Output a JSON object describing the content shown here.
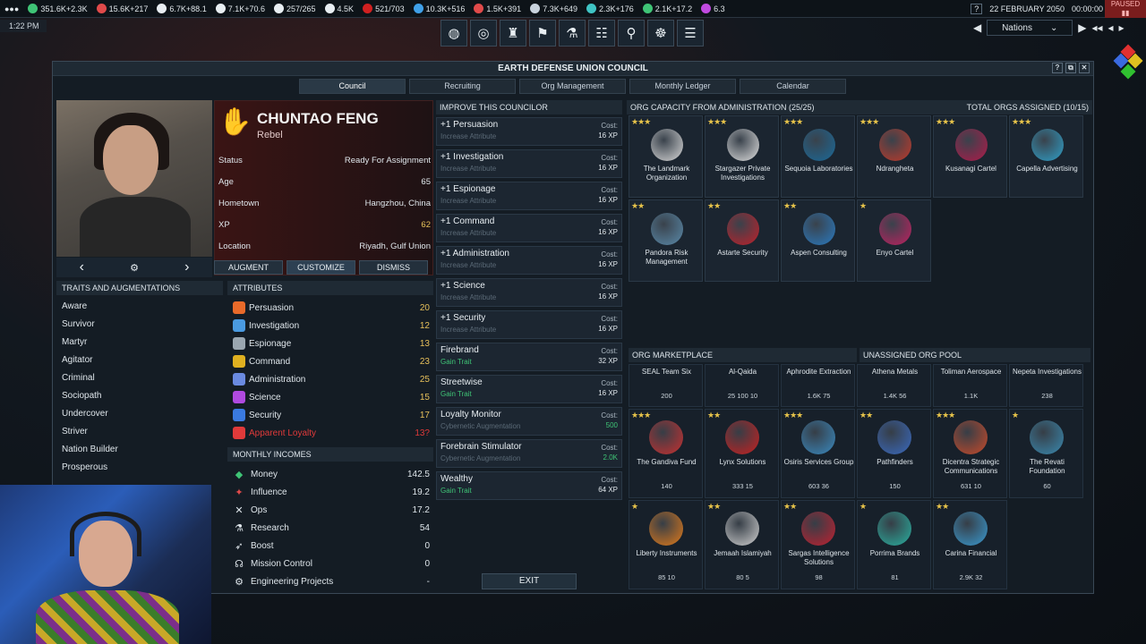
{
  "topbar": {
    "resources": [
      {
        "icon": "money-icon",
        "value": "351.6K+2.3K",
        "color": "#3fc476"
      },
      {
        "icon": "influence-icon",
        "value": "15.6K+217",
        "color": "#e04a4a"
      },
      {
        "icon": "ops-icon",
        "value": "6.7K+88.1",
        "color": "#e8eef2"
      },
      {
        "icon": "boost-icon",
        "value": "7.1K+70.6",
        "color": "#e8eef2"
      },
      {
        "icon": "mission-control-icon",
        "value": "257/265",
        "color": "#e8eef2"
      },
      {
        "icon": "research-icon",
        "value": "4.5K",
        "color": "#e8eef2"
      },
      {
        "icon": "control-points-icon",
        "value": "521/703",
        "color": "#d02020"
      },
      {
        "icon": "water-icon",
        "value": "10.3K+516",
        "color": "#3fa0e8"
      },
      {
        "icon": "volatiles-icon",
        "value": "1.5K+391",
        "color": "#e04a4a"
      },
      {
        "icon": "metals-icon",
        "value": "7.3K+649",
        "color": "#c8d2dc"
      },
      {
        "icon": "nobles-icon",
        "value": "2.3K+176",
        "color": "#3fc4c4"
      },
      {
        "icon": "fissiles-icon",
        "value": "2.1K+17.2",
        "color": "#3fc476"
      },
      {
        "icon": "antimatter-icon",
        "value": "6.3",
        "color": "#c04ae0"
      }
    ],
    "date": "22 FEBRUARY 2050",
    "clock": "00:00:00",
    "paused": "PAUSED",
    "help": "?"
  },
  "local_time": "1:22 PM",
  "nav_select": "Nations",
  "window": {
    "title": "EARTH DEFENSE UNION COUNCIL",
    "tabs": [
      "Council",
      "Recruiting",
      "Org Management",
      "Monthly Ledger",
      "Calendar"
    ]
  },
  "councilor": {
    "name": "CHUNTAO FENG",
    "faction": "Rebel",
    "rows": [
      {
        "label": "Status",
        "value": "Ready For Assignment"
      },
      {
        "label": "Age",
        "value": "65"
      },
      {
        "label": "Hometown",
        "value": "Hangzhou, China"
      },
      {
        "label": "XP",
        "value": "62"
      },
      {
        "label": "Location",
        "value": "Riyadh, Gulf Union"
      }
    ],
    "buttons": {
      "augment": "AUGMENT",
      "customize": "CUSTOMIZE",
      "dismiss": "DISMISS"
    }
  },
  "traits": {
    "header": "TRAITS AND AUGMENTATIONS",
    "items": [
      "Aware",
      "Survivor",
      "Martyr",
      "Agitator",
      "Criminal",
      "Sociopath",
      "Undercover",
      "Striver",
      "Nation Builder",
      "Prosperous"
    ]
  },
  "attributes": {
    "header": "ATTRIBUTES",
    "items": [
      {
        "name": "Persuasion",
        "value": "20",
        "color": "#e86a2a"
      },
      {
        "name": "Investigation",
        "value": "12",
        "color": "#4a9ae0"
      },
      {
        "name": "Espionage",
        "value": "13",
        "color": "#9aa6b0"
      },
      {
        "name": "Command",
        "value": "23",
        "color": "#e0b020"
      },
      {
        "name": "Administration",
        "value": "25",
        "color": "#6a8ae0"
      },
      {
        "name": "Science",
        "value": "15",
        "color": "#b04ae0"
      },
      {
        "name": "Security",
        "value": "17",
        "color": "#3a7ae0"
      },
      {
        "name": "Apparent Loyalty",
        "value": "13?",
        "color": "#e03a3a"
      }
    ]
  },
  "incomes": {
    "header": "MONTHLY INCOMES",
    "items": [
      {
        "name": "Money",
        "value": "142.5",
        "icon": "money-icon"
      },
      {
        "name": "Influence",
        "value": "19.2",
        "icon": "influence-icon"
      },
      {
        "name": "Ops",
        "value": "17.2",
        "icon": "ops-icon"
      },
      {
        "name": "Research",
        "value": "54",
        "icon": "research-icon"
      },
      {
        "name": "Boost",
        "value": "0",
        "icon": "boost-icon"
      },
      {
        "name": "Mission Control",
        "value": "0",
        "icon": "mission-control-icon"
      },
      {
        "name": "Engineering Projects",
        "value": "-",
        "icon": "engineering-icon"
      }
    ]
  },
  "improve": {
    "header": "IMPROVE THIS COUNCILOR",
    "items": [
      {
        "title": "+1 Persuasion",
        "sub": "Increase Attribute",
        "cost_label": "Cost:",
        "cost": "16 XP"
      },
      {
        "title": "+1 Investigation",
        "sub": "Increase Attribute",
        "cost_label": "Cost:",
        "cost": "16 XP"
      },
      {
        "title": "+1 Espionage",
        "sub": "Increase Attribute",
        "cost_label": "Cost:",
        "cost": "16 XP"
      },
      {
        "title": "+1 Command",
        "sub": "Increase Attribute",
        "cost_label": "Cost:",
        "cost": "16 XP"
      },
      {
        "title": "+1 Administration",
        "sub": "Increase Attribute",
        "cost_label": "Cost:",
        "cost": "16 XP"
      },
      {
        "title": "+1 Science",
        "sub": "Increase Attribute",
        "cost_label": "Cost:",
        "cost": "16 XP"
      },
      {
        "title": "+1 Security",
        "sub": "Increase Attribute",
        "cost_label": "Cost:",
        "cost": "16 XP"
      },
      {
        "title": "Firebrand",
        "sub": "Gain Trait",
        "cost_label": "Cost:",
        "cost": "32 XP"
      },
      {
        "title": "Streetwise",
        "sub": "Gain Trait",
        "cost_label": "Cost:",
        "cost": "16 XP"
      },
      {
        "title": "Loyalty Monitor",
        "sub": "Cybernetic Augmentation",
        "cost_label": "Cost:",
        "cost": "500"
      },
      {
        "title": "Forebrain Stimulator",
        "sub": "Cybernetic Augmentation",
        "cost_label": "Cost:",
        "cost": "2.0K"
      },
      {
        "title": "Wealthy",
        "sub": "Gain Trait",
        "cost_label": "Cost:",
        "cost": "64 XP"
      }
    ],
    "exit": "EXIT"
  },
  "org_capacity": {
    "header": "ORG CAPACITY FROM ADMINISTRATION (25/25)",
    "total": "TOTAL ORGS ASSIGNED (10/15)",
    "orgs": [
      {
        "name": "The Landmark Organization",
        "stars": "★★★",
        "color": "#d8d8d8"
      },
      {
        "name": "Stargazer Private Investigations",
        "stars": "★★★",
        "color": "#e0e0e0"
      },
      {
        "name": "Sequoia Laboratories",
        "stars": "★★★",
        "color": "#1a6a9a"
      },
      {
        "name": "Ndrangheta",
        "stars": "★★★",
        "color": "#c03a2a"
      },
      {
        "name": "Kusanagi Cartel",
        "stars": "★★★",
        "color": "#b01a4a"
      },
      {
        "name": "Capella Advertising",
        "stars": "★★★",
        "color": "#30a0c8"
      },
      {
        "name": "Pandora Risk Management",
        "stars": "★★",
        "color": "#5a8aaa"
      },
      {
        "name": "Astarte Security",
        "stars": "★★",
        "color": "#c0202a"
      },
      {
        "name": "Aspen Consulting",
        "stars": "★★",
        "color": "#2a7ac0"
      },
      {
        "name": "Enyo Cartel",
        "stars": "★",
        "color": "#c02060"
      }
    ]
  },
  "market": {
    "header": "ORG MARKETPLACE",
    "pool_header": "UNASSIGNED ORG POOL",
    "top_row": [
      {
        "name": "SEAL Team Six",
        "cost": "200"
      },
      {
        "name": "Al-Qaida",
        "cost": "25 100 10"
      },
      {
        "name": "Aphrodite Extraction",
        "cost": "1.6K 75"
      },
      {
        "name": "Athena Metals",
        "cost": "1.4K 56"
      },
      {
        "name": "Toliman Aerospace",
        "cost": "1.1K"
      },
      {
        "name": "Nepeta Investigations",
        "cost": "238"
      }
    ],
    "rows": [
      {
        "name": "The Gandiva Fund",
        "stars": "★★★",
        "cost": "140",
        "color": "#c83030"
      },
      {
        "name": "Lynx Solutions",
        "stars": "★★",
        "cost": "333 15",
        "color": "#c82020"
      },
      {
        "name": "Osiris Services Group",
        "stars": "★★★",
        "cost": "603 36",
        "color": "#3a8ac0"
      },
      {
        "name": "Pathfinders",
        "stars": "★★",
        "cost": "150",
        "color": "#3a6ac0"
      },
      {
        "name": "Dicentra Strategic Communications",
        "stars": "★★★",
        "cost": "631 10",
        "color": "#c84a2a"
      },
      {
        "name": "The Revati Foundation",
        "stars": "★",
        "cost": "60",
        "color": "#3a8ab0"
      },
      {
        "name": "Liberty Instruments",
        "stars": "★",
        "cost": "85 10",
        "color": "#e07a1a"
      },
      {
        "name": "Jemaah Islamiyah",
        "stars": "★★",
        "cost": "80 5",
        "color": "#d0d0d0"
      },
      {
        "name": "Sargas Intelligence Solutions",
        "stars": "★★",
        "cost": "98",
        "color": "#c02030"
      },
      {
        "name": "Porrima Brands",
        "stars": "★",
        "cost": "81",
        "color": "#2ab0a0"
      },
      {
        "name": "Carina Financial",
        "stars": "★★",
        "cost": "2.9K 32",
        "color": "#3a9ad0"
      }
    ]
  }
}
